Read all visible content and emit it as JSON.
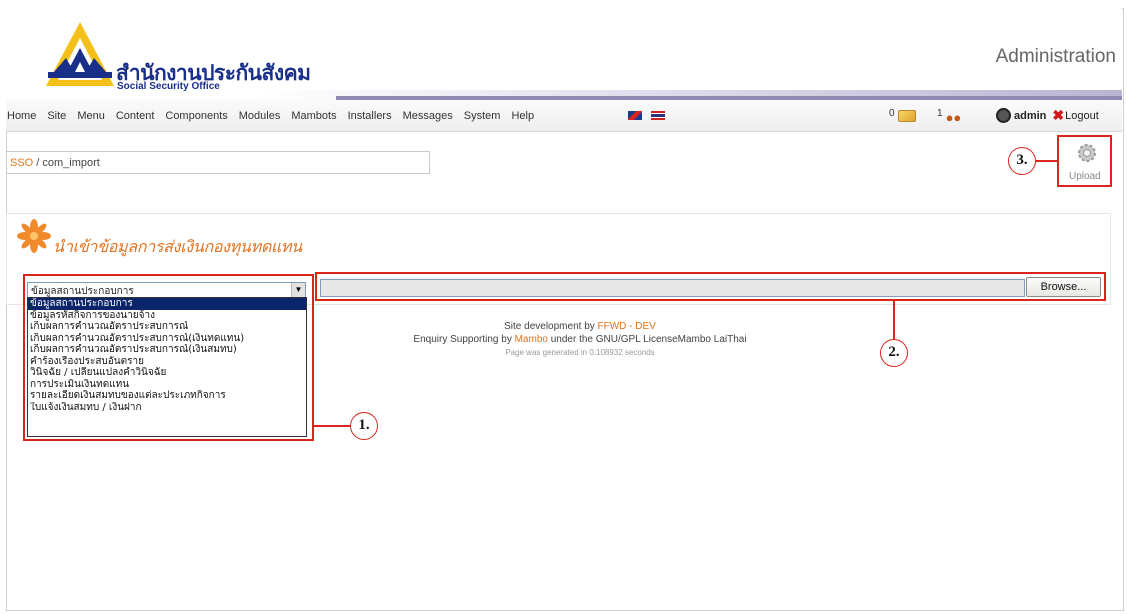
{
  "header": {
    "logo_thai": "สำนักงานประกันสังคม",
    "logo_eng": "Social Security Office",
    "admin_title": "Administration"
  },
  "menu": {
    "items": [
      "Home",
      "Site",
      "Menu",
      "Content",
      "Components",
      "Modules",
      "Mambots",
      "Installers",
      "Messages",
      "System",
      "Help"
    ],
    "messages_count": "0",
    "users_count": "1",
    "username": "admin",
    "logout_label": "Logout"
  },
  "pathway": {
    "site": "SSO",
    "component": " / com_import"
  },
  "toolbar": {
    "upload_label": "Upload"
  },
  "content": {
    "title": "นำเข้าข้อมูลการส่งเงินกองทุนทดแทน",
    "select_value": "ข้อมูลสถานประกอบการ",
    "options": [
      "ข้อมูลสถานประกอบการ",
      "ข้อมูลรหัสกิจการของนายจ้าง",
      "เก็บผลการคำนวณอัตราประสบการณ์",
      "เก็บผลการคำนวณอัตราประสบการณ์(เงินทดแทน)",
      "เก็บผลการคำนวณอัตราประสบการณ์(เงินสมทบ)",
      "คำร้องเรื่องประสบอันตราย",
      "วินิจฉัย / เปลี่ยนแปลงคำวินิจฉัย",
      "การประเมินเงินทดแทน",
      "รายละเอียดเงินสมทบของแต่ละประเภทกิจการ",
      "ใบแจ้งเงินสมทบ / เงินฝาก"
    ],
    "selected_index": 0,
    "browse_label": "Browse..."
  },
  "footer": {
    "line1_prefix": "Site development by ",
    "line1_link": "FFWD - DEV",
    "line2_prefix": "Enquiry Supporting by ",
    "line2_link": "Mambo",
    "line2_suffix": " under the GNU/GPL LicenseMambo LaiThai",
    "line3": "Page was generated in 0.108932 seconds"
  },
  "callouts": [
    "1.",
    "2.",
    "3."
  ],
  "colors": {
    "accent_orange": "#e37422",
    "logo_blue": "#1a2f8a",
    "callout_red": "#d9251c",
    "selection_blue": "#0b246a"
  },
  "icons": {
    "messages": "mail-icon",
    "users": "users-icon",
    "admin": "admin-user-icon",
    "logout": "logout-x-icon",
    "upload": "upload-gear-icon",
    "title": "orange-star-icon"
  }
}
